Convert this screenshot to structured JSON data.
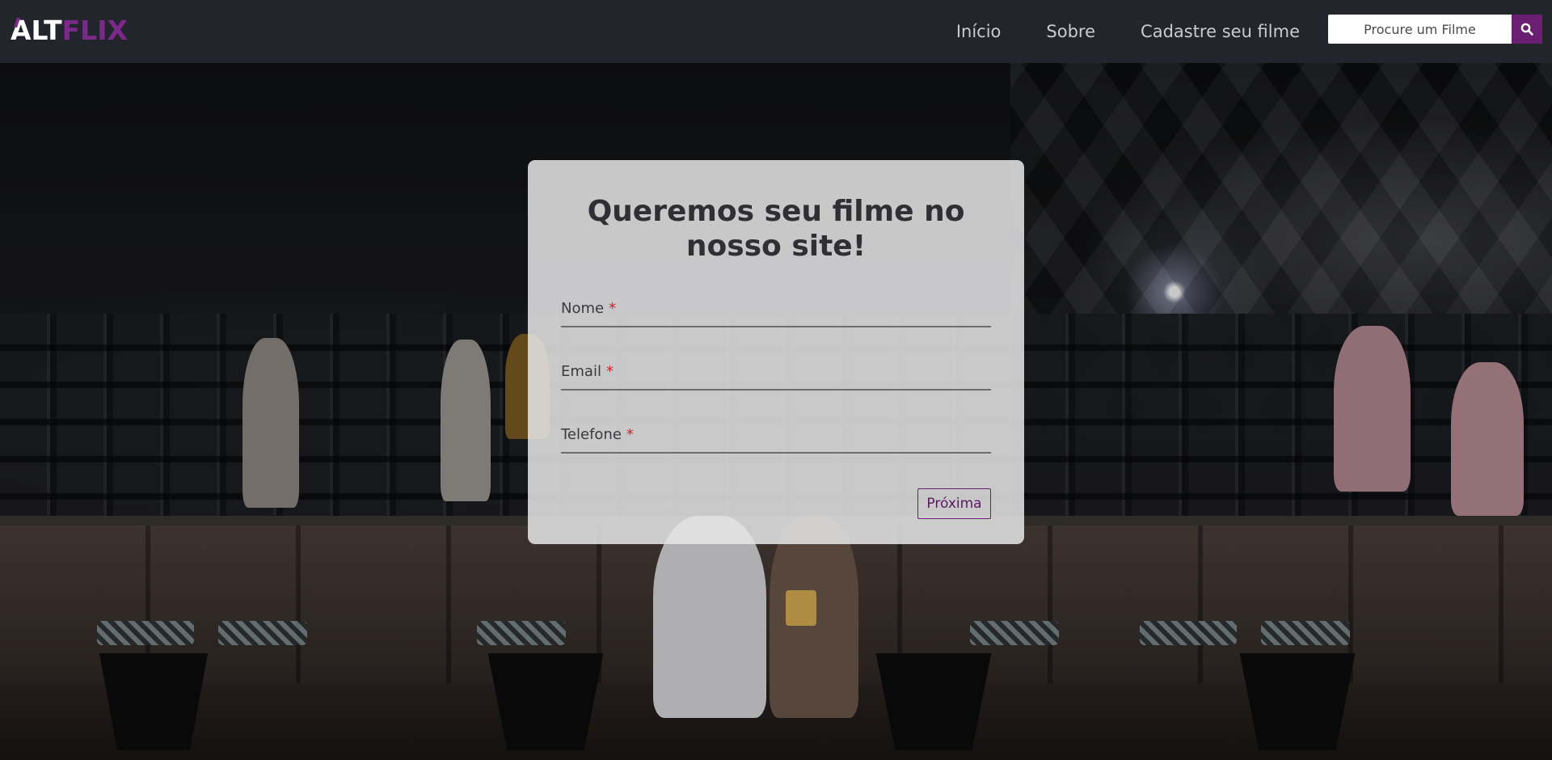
{
  "brand": {
    "logo_alt": "ALT",
    "logo_flix": "FLIX"
  },
  "nav": {
    "links": [
      {
        "label": "Início"
      },
      {
        "label": "Sobre"
      },
      {
        "label": "Cadastre seu filme"
      }
    ]
  },
  "search": {
    "placeholder": "Procure um Filme",
    "icon": "search-icon"
  },
  "form": {
    "title": "Queremos seu filme no nosso site!",
    "fields": [
      {
        "label": "Nome",
        "required_mark": "*"
      },
      {
        "label": "Email",
        "required_mark": "*"
      },
      {
        "label": "Telefone",
        "required_mark": "*"
      }
    ],
    "next_label": "Próxima"
  },
  "colors": {
    "navbar": "#22252b",
    "accent_purple": "#6b1f72",
    "nav_text": "#c9cbd0",
    "required": "#d0202a"
  }
}
